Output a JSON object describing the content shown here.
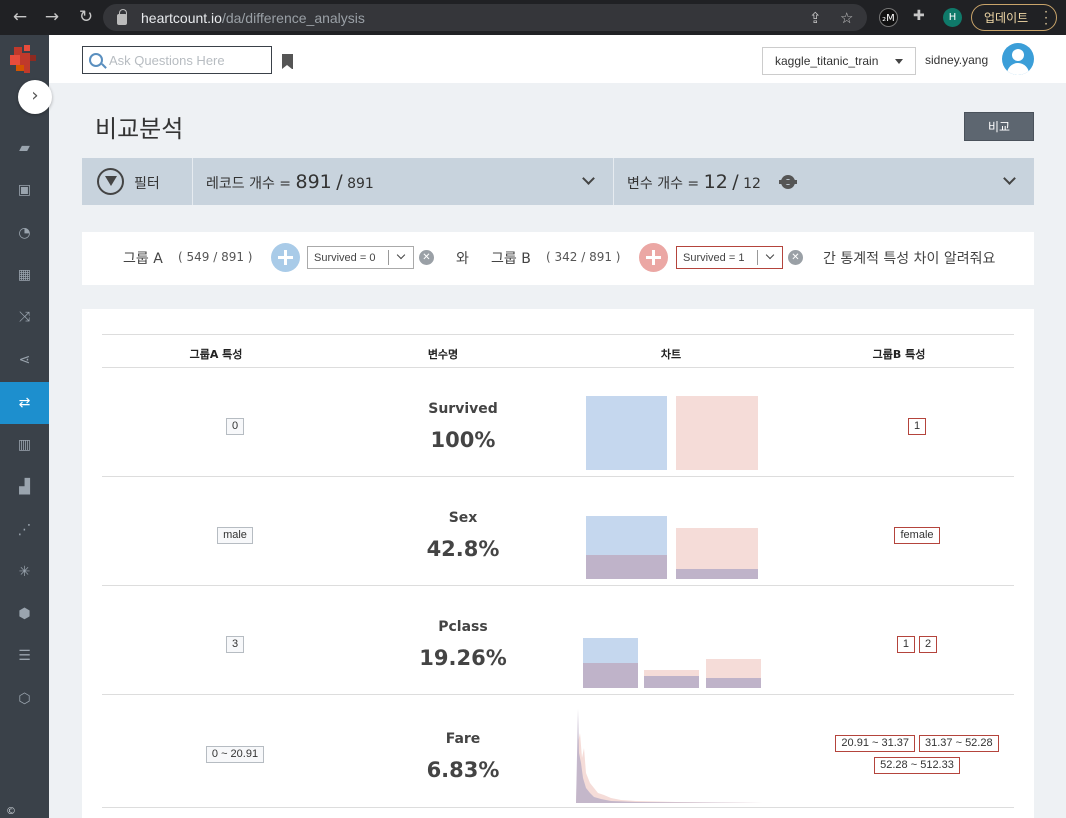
{
  "browser": {
    "url_host": "heartcount.io",
    "url_path": "/da/difference_analysis",
    "profile_initial": "H",
    "ext_initial": "₂M",
    "update_label": "업데이트"
  },
  "sidebar": {
    "copyright": "©",
    "icons": [
      "folder-add-icon",
      "folder-image-icon",
      "rocket-icon",
      "dashboard-icon",
      "shuffle-icon",
      "share-icon",
      "compare-icon",
      "grid-chart-icon",
      "bar-chart-icon",
      "scatter-icon",
      "snowflake-icon",
      "cube-icon",
      "hbar-icon",
      "settings-hex-icon"
    ],
    "active_index": 6
  },
  "header": {
    "search_placeholder": "Ask Questions Here",
    "dataset": "kaggle_titanic_train",
    "username": "sidney.yang"
  },
  "page": {
    "title": "비교분석",
    "compare_button": "비교"
  },
  "filter_bar": {
    "filter_label": "필터",
    "record_label": "레코드 개수 =",
    "record_count": "891",
    "record_sep": "/",
    "record_total": "891",
    "var_label": "변수 개수 =",
    "var_count": "12",
    "var_sep": "/",
    "var_total": "12"
  },
  "groups": {
    "a_label": "그룹 A",
    "a_count": "( 549 / 891 )",
    "a_condition": "Survived = 0",
    "conj": "와",
    "b_label": "그룹 B",
    "b_count": "( 342 / 891 )",
    "b_condition": "Survived = 1",
    "suffix": "간 통계적 특성 차이 알려줘요"
  },
  "table": {
    "headers": {
      "a": "그룹A 특성",
      "var": "변수명",
      "chart": "차트",
      "b": "그룹B 특성"
    },
    "rows": [
      {
        "name": "Survived",
        "pct": "100%",
        "a_tags": [
          "0"
        ],
        "b_tags": [
          "1"
        ]
      },
      {
        "name": "Sex",
        "pct": "42.8%",
        "a_tags": [
          "male"
        ],
        "b_tags": [
          "female"
        ]
      },
      {
        "name": "Pclass",
        "pct": "19.26%",
        "a_tags": [
          "3"
        ],
        "b_tags": [
          "1",
          "2"
        ]
      },
      {
        "name": "Fare",
        "pct": "6.83%",
        "a_tags": [
          "0 ~ 20.91"
        ],
        "b_tags": [
          "20.91 ~ 31.37",
          "31.37 ~ 52.28",
          "52.28 ~ 512.33"
        ]
      }
    ]
  },
  "colors": {
    "group_a": "#c5d7ee",
    "group_b": "#f5dcd8",
    "overlap": "#bfb3c9",
    "active_nav": "#1d8fce"
  }
}
